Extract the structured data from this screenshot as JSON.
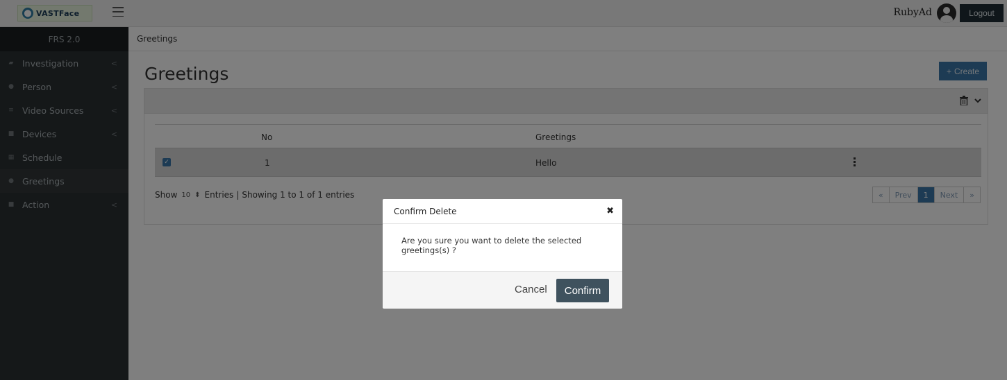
{
  "app": {
    "logo_text": "VASTFace",
    "version": "FRS 2.0",
    "user_name": "RubyAd",
    "logout_label": "Logout"
  },
  "sidebar": {
    "items": [
      {
        "label": "Investigation",
        "icon": "car-icon",
        "has_submenu": true
      },
      {
        "label": "Person",
        "icon": "user-icon",
        "has_submenu": true
      },
      {
        "label": "Video Sources",
        "icon": "list-icon",
        "has_submenu": true
      },
      {
        "label": "Devices",
        "icon": "device-icon",
        "has_submenu": true
      },
      {
        "label": "Schedule",
        "icon": "calendar-icon",
        "has_submenu": false
      },
      {
        "label": "Greetings",
        "icon": "chat-icon",
        "has_submenu": false,
        "active": true
      },
      {
        "label": "Action",
        "icon": "video-icon",
        "has_submenu": true
      }
    ]
  },
  "breadcrumb": "Greetings",
  "page": {
    "title": "Greetings",
    "create_label": "Create"
  },
  "table": {
    "headers": [
      "No",
      "Greetings"
    ],
    "rows": [
      {
        "no": "1",
        "greeting": "Hello",
        "checked": true
      }
    ]
  },
  "footer": {
    "show_label": "Show",
    "entries_value": "10",
    "entries_label": "Entries",
    "separator": "|",
    "showing_text": "Showing 1 to 1 of 1 entries"
  },
  "pagination": {
    "first": "«",
    "prev": "Prev",
    "current": "1",
    "next": "Next",
    "last": "»"
  },
  "modal": {
    "title": "Confirm Delete",
    "message": "Are you sure you want to delete the selected greetings(s) ?",
    "cancel_label": "Cancel",
    "confirm_label": "Confirm"
  },
  "colors": {
    "primary": "#3a77a8",
    "sidebar_bg": "#2b3033",
    "confirm_bg": "#3f525e",
    "logout_bg": "#1f2d35"
  }
}
